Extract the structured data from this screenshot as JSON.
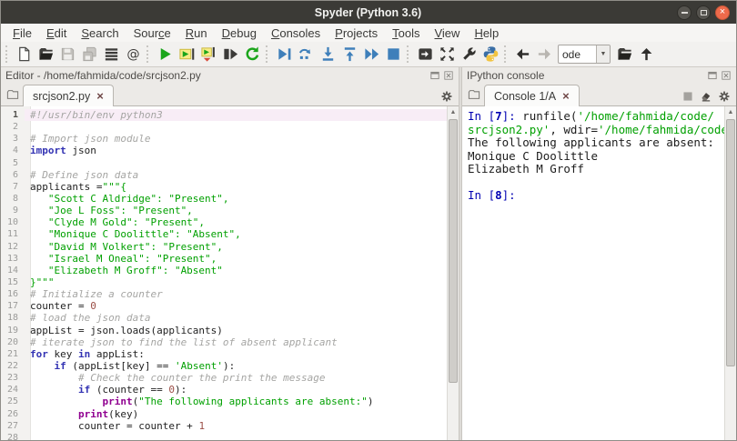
{
  "window": {
    "title": "Spyder (Python 3.6)"
  },
  "menu": {
    "items": [
      {
        "label": "File",
        "underline": 0
      },
      {
        "label": "Edit",
        "underline": 0
      },
      {
        "label": "Search",
        "underline": 0
      },
      {
        "label": "Source",
        "underline": 4
      },
      {
        "label": "Run",
        "underline": 0
      },
      {
        "label": "Debug",
        "underline": 0
      },
      {
        "label": "Consoles",
        "underline": 0
      },
      {
        "label": "Projects",
        "underline": 0
      },
      {
        "label": "Tools",
        "underline": 0
      },
      {
        "label": "View",
        "underline": 0
      },
      {
        "label": "Help",
        "underline": 0
      }
    ]
  },
  "toolbar": {
    "groups": [
      {
        "items": [
          {
            "name": "new-file-button",
            "icon": "page"
          },
          {
            "name": "open-file-button",
            "icon": "folder"
          },
          {
            "name": "save-button",
            "icon": "floppy",
            "disabled": true
          },
          {
            "name": "save-all-button",
            "icon": "floppy2",
            "disabled": true
          },
          {
            "name": "file-switcher-button",
            "icon": "list"
          },
          {
            "name": "find-symbols-button",
            "icon": "at"
          }
        ]
      },
      {
        "items": [
          {
            "name": "run-file-button",
            "icon": "play"
          },
          {
            "name": "run-cell-button",
            "icon": "runcell"
          },
          {
            "name": "run-cell-advance-button",
            "icon": "runcelladv"
          },
          {
            "name": "run-selection-button",
            "icon": "runsel"
          },
          {
            "name": "rerun-last-script-button",
            "icon": "rerun"
          }
        ]
      },
      {
        "items": [
          {
            "name": "debug-file-button",
            "icon": "debug"
          },
          {
            "name": "step-over-button",
            "icon": "stepover"
          },
          {
            "name": "step-into-button",
            "icon": "stepinto"
          },
          {
            "name": "step-return-button",
            "icon": "stepreturn"
          },
          {
            "name": "continue-execution-button",
            "icon": "cont"
          },
          {
            "name": "stop-debugging-button",
            "icon": "stopblue"
          }
        ]
      },
      {
        "items": [
          {
            "name": "open-ipython-console-button",
            "icon": "external"
          },
          {
            "name": "maximize-pane-button",
            "icon": "maximize"
          },
          {
            "name": "preferences-button",
            "icon": "wrench"
          },
          {
            "name": "python-path-manager-button",
            "icon": "python"
          }
        ]
      },
      {
        "items": [
          {
            "name": "back-button",
            "icon": "arrowleft"
          },
          {
            "name": "forward-button",
            "icon": "arrowright",
            "disabled": true
          }
        ]
      }
    ],
    "workdir_value": "ode",
    "after_combo": [
      {
        "name": "browse-working-directory-button",
        "icon": "folder"
      },
      {
        "name": "parent-directory-button",
        "icon": "arrowup"
      }
    ]
  },
  "editor": {
    "pane_title": "Editor - /home/fahmida/code/srcjson2.py",
    "tab_label": "srcjson2.py",
    "lines": [
      {
        "hl": true,
        "t": [
          [
            "com",
            "#!/usr/bin/env python3"
          ]
        ]
      },
      {
        "t": []
      },
      {
        "t": [
          [
            "com",
            "# Import json module"
          ]
        ]
      },
      {
        "t": [
          [
            "kw",
            "import"
          ],
          [
            "pl",
            " json"
          ]
        ]
      },
      {
        "t": []
      },
      {
        "t": [
          [
            "com",
            "# Define json data"
          ]
        ]
      },
      {
        "t": [
          [
            "pl",
            "applicants ="
          ],
          [
            "str",
            "\"\"\"{"
          ]
        ]
      },
      {
        "t": [
          [
            "str",
            "   \"Scott C Aldridge\": \"Present\","
          ]
        ]
      },
      {
        "t": [
          [
            "str",
            "   \"Joe L Foss\": \"Present\","
          ]
        ]
      },
      {
        "t": [
          [
            "str",
            "   \"Clyde M Gold\": \"Present\","
          ]
        ]
      },
      {
        "t": [
          [
            "str",
            "   \"Monique C Doolittle\": \"Absent\","
          ]
        ]
      },
      {
        "t": [
          [
            "str",
            "   \"David M Volkert\": \"Present\","
          ]
        ]
      },
      {
        "t": [
          [
            "str",
            "   \"Israel M Oneal\": \"Present\","
          ]
        ]
      },
      {
        "t": [
          [
            "str",
            "   \"Elizabeth M Groff\": \"Absent\""
          ]
        ]
      },
      {
        "t": [
          [
            "str",
            "}\"\"\""
          ]
        ]
      },
      {
        "t": [
          [
            "com",
            "# Initialize a counter"
          ]
        ]
      },
      {
        "t": [
          [
            "pl",
            "counter = "
          ],
          [
            "num",
            "0"
          ]
        ]
      },
      {
        "t": [
          [
            "com",
            "# load the json data"
          ]
        ]
      },
      {
        "t": [
          [
            "pl",
            "appList = json.loads(applicants)"
          ]
        ]
      },
      {
        "t": [
          [
            "com",
            "# iterate json to find the list of absent applicant"
          ]
        ]
      },
      {
        "t": [
          [
            "kw",
            "for"
          ],
          [
            "pl",
            " key "
          ],
          [
            "kw",
            "in"
          ],
          [
            "pl",
            " appList:"
          ]
        ]
      },
      {
        "t": [
          [
            "pl",
            "    "
          ],
          [
            "kw",
            "if"
          ],
          [
            "pl",
            " (appList[key] == "
          ],
          [
            "str",
            "'Absent'"
          ],
          [
            "pl",
            "):"
          ]
        ]
      },
      {
        "t": [
          [
            "com",
            "        # Check the counter the print the message"
          ]
        ]
      },
      {
        "t": [
          [
            "pl",
            "        "
          ],
          [
            "kw",
            "if"
          ],
          [
            "pl",
            " (counter == "
          ],
          [
            "num",
            "0"
          ],
          [
            "pl",
            "):"
          ]
        ]
      },
      {
        "t": [
          [
            "pl",
            "            "
          ],
          [
            "bi",
            "print"
          ],
          [
            "pl",
            "("
          ],
          [
            "str",
            "\"The following applicants are absent:\""
          ],
          [
            "pl",
            ")"
          ]
        ]
      },
      {
        "t": [
          [
            "pl",
            "        "
          ],
          [
            "bi",
            "print"
          ],
          [
            "pl",
            "(key)"
          ]
        ]
      },
      {
        "t": [
          [
            "pl",
            "        counter = counter + "
          ],
          [
            "num",
            "1"
          ]
        ]
      },
      {
        "t": []
      }
    ]
  },
  "console": {
    "pane_title": "IPython console",
    "tab_label": "Console 1/A",
    "lines": [
      {
        "t": [
          [
            "prompt",
            "In ["
          ],
          [
            "pnum",
            "7"
          ],
          [
            "prompt",
            "]: "
          ],
          [
            "pl",
            "runfile("
          ],
          [
            "str",
            "'/home/fahmida/code/"
          ]
        ]
      },
      {
        "t": [
          [
            "str",
            "srcjson2.py'"
          ],
          [
            "pl",
            ", wdir="
          ],
          [
            "str",
            "'/home/fahmida/code'"
          ],
          [
            "pl",
            ")"
          ]
        ]
      },
      {
        "t": [
          [
            "pl",
            "The following applicants are absent:"
          ]
        ]
      },
      {
        "t": [
          [
            "pl",
            "Monique C Doolittle"
          ]
        ]
      },
      {
        "t": [
          [
            "pl",
            "Elizabeth M Groff"
          ]
        ]
      },
      {
        "t": []
      },
      {
        "t": [
          [
            "prompt",
            "In ["
          ],
          [
            "pnum",
            "8"
          ],
          [
            "prompt",
            "]: "
          ]
        ]
      }
    ]
  },
  "colors": {
    "titlebar_bg": "#3b3a36",
    "close_orange": "#ee6a4b",
    "run_green": "#1ba51b",
    "debug_blue": "#3e7fba",
    "string_green": "#00a000",
    "keyword_blue": "#3333b3",
    "builtin_purple": "#900090",
    "number_brown": "#9b4e46",
    "comment_gray": "#a5a5a3",
    "prompt_navy": "#0000b2",
    "current_line_pink": "#f8edf6"
  }
}
